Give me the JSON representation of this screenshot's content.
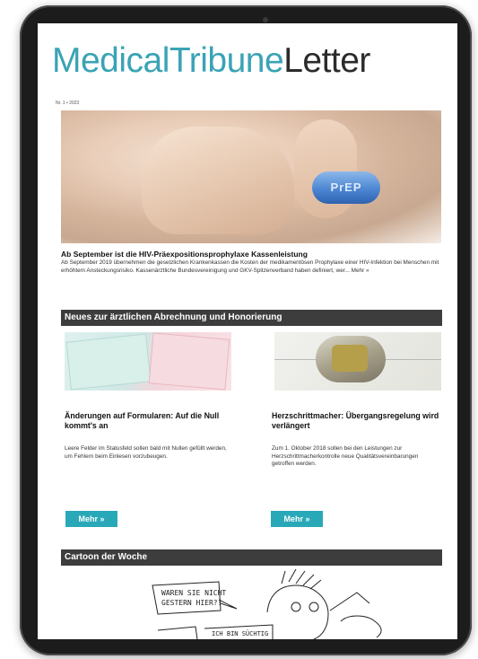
{
  "newsletter": {
    "masthead_part1": "MedicalTribune",
    "masthead_part2": "Letter",
    "issue": "Nr. 1 • 2023"
  },
  "hero": {
    "pill_text": "PrEP"
  },
  "lead": {
    "title": "Ab September ist die HIV-Präexpositionsprophylaxe Kassenleistung",
    "text": "Ab September 2019 übernehmen die gesetzlichen Krankenkassen die Kosten der medikamentösen Prophylaxe einer HIV-Infektion bei Menschen mit erhöhtem Ansteckungsrisiko. Kassenärztliche Bundesvereinigung und GKV-Spitzenverband haben definiert, wer...",
    "more_link": "Mehr »"
  },
  "section1": {
    "title": "Neues zur ärztlichen Abrechnung und Honorierung"
  },
  "articles": [
    {
      "title": "Änderungen auf Formularen: Auf die Null kommt's an",
      "text": "Leere Felder im Statusfeld sollen bald mit Nullen gefüllt werden, um Fehlern beim Einlesen vorzubeugen.",
      "button": "Mehr »"
    },
    {
      "title": "Herzschrittmacher: Übergangsregelung wird verlängert",
      "text": "Zum 1. Oktober 2018 sollen bei den Leistungen zur Herzschrittmacherkontrolle neue Qualitätsvereinbarungen getroffen werden.",
      "button": "Mehr »"
    }
  ],
  "section2": {
    "title": "Cartoon der Woche"
  },
  "cartoon": {
    "bubble1": "WAREN SIE NICHT GESTERN HIER?!",
    "bubble2": "ICH BIN SÜCHTIG"
  }
}
